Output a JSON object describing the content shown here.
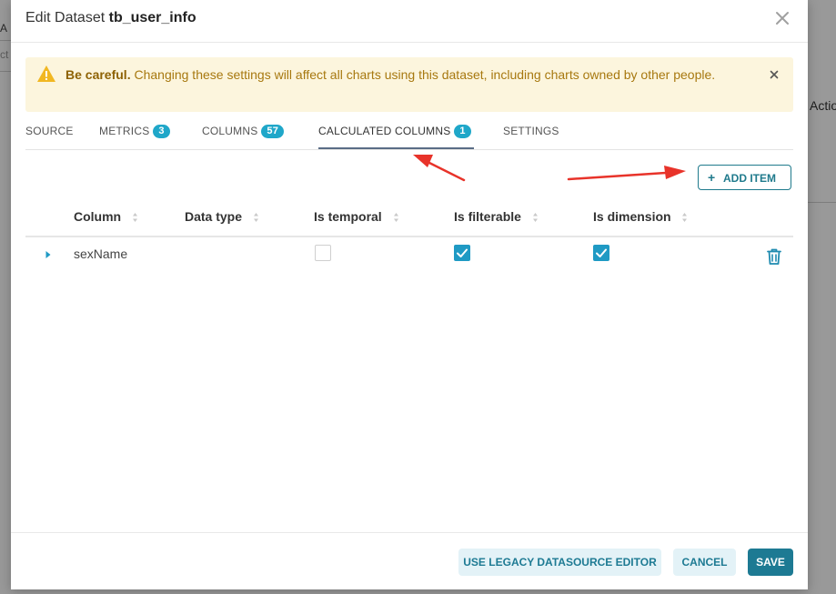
{
  "background": {
    "fragment_a": "A",
    "fragment_b": "ct",
    "fragment_c": "Actio"
  },
  "modal": {
    "title_prefix": "Edit Dataset ",
    "title_name": "tb_user_info"
  },
  "alert": {
    "strong": "Be careful.",
    "message": " Changing these settings will affect all charts using this dataset, including charts owned by other people."
  },
  "tabs": [
    {
      "label": "SOURCE",
      "badge": null
    },
    {
      "label": "METRICS",
      "badge": "3"
    },
    {
      "label": "COLUMNS",
      "badge": "57"
    },
    {
      "label": "CALCULATED COLUMNS",
      "badge": "1"
    },
    {
      "label": "SETTINGS",
      "badge": null
    }
  ],
  "active_tab": "CALCULATED COLUMNS",
  "add_item_label": "ADD ITEM",
  "table": {
    "headers": [
      "Column",
      "Data type",
      "Is temporal",
      "Is filterable",
      "Is dimension"
    ],
    "rows": [
      {
        "column": "sexName",
        "data_type": "",
        "is_temporal": false,
        "is_filterable": true,
        "is_dimension": true
      }
    ]
  },
  "footer": {
    "legacy_label": "USE LEGACY DATASOURCE EDITOR",
    "cancel_label": "CANCEL",
    "save_label": "SAVE"
  },
  "colors": {
    "primary": "#1d7a93",
    "badge": "#1fa7c9",
    "checkbox": "#1f9ac4",
    "warning_bg": "#fcf5dd",
    "warning_text": "#a7780f",
    "annotation_arrow": "#e8332a"
  },
  "icons": {
    "close": "close-icon",
    "warning": "warning-triangle-icon",
    "expand": "caret-right-icon",
    "sort": "sort-icon",
    "check": "check-icon",
    "delete": "trash-icon",
    "add": "plus-icon"
  }
}
